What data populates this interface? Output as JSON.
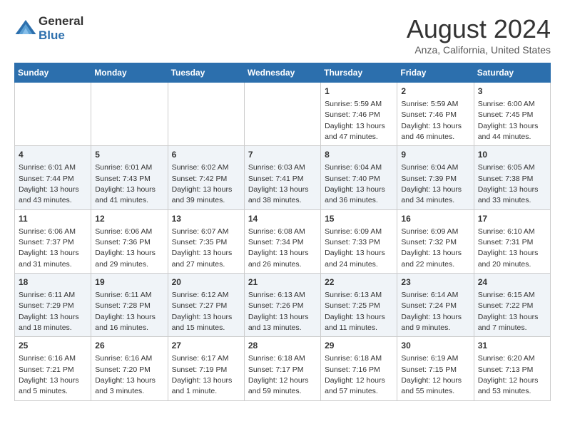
{
  "header": {
    "logo": {
      "general": "General",
      "blue": "Blue"
    },
    "month": "August 2024",
    "location": "Anza, California, United States"
  },
  "weekdays": [
    "Sunday",
    "Monday",
    "Tuesday",
    "Wednesday",
    "Thursday",
    "Friday",
    "Saturday"
  ],
  "weeks": [
    [
      {
        "day": "",
        "info": ""
      },
      {
        "day": "",
        "info": ""
      },
      {
        "day": "",
        "info": ""
      },
      {
        "day": "",
        "info": ""
      },
      {
        "day": "1",
        "info": "Sunrise: 5:59 AM\nSunset: 7:46 PM\nDaylight: 13 hours\nand 47 minutes."
      },
      {
        "day": "2",
        "info": "Sunrise: 5:59 AM\nSunset: 7:46 PM\nDaylight: 13 hours\nand 46 minutes."
      },
      {
        "day": "3",
        "info": "Sunrise: 6:00 AM\nSunset: 7:45 PM\nDaylight: 13 hours\nand 44 minutes."
      }
    ],
    [
      {
        "day": "4",
        "info": "Sunrise: 6:01 AM\nSunset: 7:44 PM\nDaylight: 13 hours\nand 43 minutes."
      },
      {
        "day": "5",
        "info": "Sunrise: 6:01 AM\nSunset: 7:43 PM\nDaylight: 13 hours\nand 41 minutes."
      },
      {
        "day": "6",
        "info": "Sunrise: 6:02 AM\nSunset: 7:42 PM\nDaylight: 13 hours\nand 39 minutes."
      },
      {
        "day": "7",
        "info": "Sunrise: 6:03 AM\nSunset: 7:41 PM\nDaylight: 13 hours\nand 38 minutes."
      },
      {
        "day": "8",
        "info": "Sunrise: 6:04 AM\nSunset: 7:40 PM\nDaylight: 13 hours\nand 36 minutes."
      },
      {
        "day": "9",
        "info": "Sunrise: 6:04 AM\nSunset: 7:39 PM\nDaylight: 13 hours\nand 34 minutes."
      },
      {
        "day": "10",
        "info": "Sunrise: 6:05 AM\nSunset: 7:38 PM\nDaylight: 13 hours\nand 33 minutes."
      }
    ],
    [
      {
        "day": "11",
        "info": "Sunrise: 6:06 AM\nSunset: 7:37 PM\nDaylight: 13 hours\nand 31 minutes."
      },
      {
        "day": "12",
        "info": "Sunrise: 6:06 AM\nSunset: 7:36 PM\nDaylight: 13 hours\nand 29 minutes."
      },
      {
        "day": "13",
        "info": "Sunrise: 6:07 AM\nSunset: 7:35 PM\nDaylight: 13 hours\nand 27 minutes."
      },
      {
        "day": "14",
        "info": "Sunrise: 6:08 AM\nSunset: 7:34 PM\nDaylight: 13 hours\nand 26 minutes."
      },
      {
        "day": "15",
        "info": "Sunrise: 6:09 AM\nSunset: 7:33 PM\nDaylight: 13 hours\nand 24 minutes."
      },
      {
        "day": "16",
        "info": "Sunrise: 6:09 AM\nSunset: 7:32 PM\nDaylight: 13 hours\nand 22 minutes."
      },
      {
        "day": "17",
        "info": "Sunrise: 6:10 AM\nSunset: 7:31 PM\nDaylight: 13 hours\nand 20 minutes."
      }
    ],
    [
      {
        "day": "18",
        "info": "Sunrise: 6:11 AM\nSunset: 7:29 PM\nDaylight: 13 hours\nand 18 minutes."
      },
      {
        "day": "19",
        "info": "Sunrise: 6:11 AM\nSunset: 7:28 PM\nDaylight: 13 hours\nand 16 minutes."
      },
      {
        "day": "20",
        "info": "Sunrise: 6:12 AM\nSunset: 7:27 PM\nDaylight: 13 hours\nand 15 minutes."
      },
      {
        "day": "21",
        "info": "Sunrise: 6:13 AM\nSunset: 7:26 PM\nDaylight: 13 hours\nand 13 minutes."
      },
      {
        "day": "22",
        "info": "Sunrise: 6:13 AM\nSunset: 7:25 PM\nDaylight: 13 hours\nand 11 minutes."
      },
      {
        "day": "23",
        "info": "Sunrise: 6:14 AM\nSunset: 7:24 PM\nDaylight: 13 hours\nand 9 minutes."
      },
      {
        "day": "24",
        "info": "Sunrise: 6:15 AM\nSunset: 7:22 PM\nDaylight: 13 hours\nand 7 minutes."
      }
    ],
    [
      {
        "day": "25",
        "info": "Sunrise: 6:16 AM\nSunset: 7:21 PM\nDaylight: 13 hours\nand 5 minutes."
      },
      {
        "day": "26",
        "info": "Sunrise: 6:16 AM\nSunset: 7:20 PM\nDaylight: 13 hours\nand 3 minutes."
      },
      {
        "day": "27",
        "info": "Sunrise: 6:17 AM\nSunset: 7:19 PM\nDaylight: 13 hours\nand 1 minute."
      },
      {
        "day": "28",
        "info": "Sunrise: 6:18 AM\nSunset: 7:17 PM\nDaylight: 12 hours\nand 59 minutes."
      },
      {
        "day": "29",
        "info": "Sunrise: 6:18 AM\nSunset: 7:16 PM\nDaylight: 12 hours\nand 57 minutes."
      },
      {
        "day": "30",
        "info": "Sunrise: 6:19 AM\nSunset: 7:15 PM\nDaylight: 12 hours\nand 55 minutes."
      },
      {
        "day": "31",
        "info": "Sunrise: 6:20 AM\nSunset: 7:13 PM\nDaylight: 12 hours\nand 53 minutes."
      }
    ]
  ]
}
